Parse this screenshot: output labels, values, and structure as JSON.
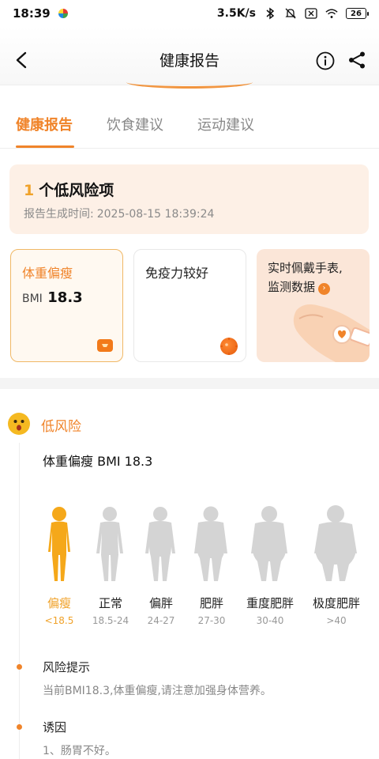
{
  "status": {
    "time": "18:39",
    "network_speed": "3.5K/s",
    "battery": "26"
  },
  "nav": {
    "title": "健康报告"
  },
  "tabs": [
    {
      "label": "健康报告",
      "active": true
    },
    {
      "label": "饮食建议",
      "active": false
    },
    {
      "label": "运动建议",
      "active": false
    }
  ],
  "summary": {
    "risk_count": "1",
    "risk_text": "个低风险项",
    "time_label": "报告生成时间:",
    "time_value": "2025-08-15 18:39:24"
  },
  "cards": {
    "weight": {
      "label": "体重偏瘦",
      "bmi_label": "BMI",
      "bmi_value": "18.3"
    },
    "immunity": {
      "label": "免疫力较好"
    },
    "watch": {
      "line1": "实时佩戴手表,",
      "line2": "监测数据"
    }
  },
  "risk_level": {
    "label": "低风险",
    "bmi_title": "体重偏瘦  BMI 18.3"
  },
  "bmi_categories": [
    {
      "name": "偏瘦",
      "range": "<18.5",
      "active": true
    },
    {
      "name": "正常",
      "range": "18.5-24",
      "active": false
    },
    {
      "name": "偏胖",
      "range": "24-27",
      "active": false
    },
    {
      "name": "肥胖",
      "range": "27-30",
      "active": false
    },
    {
      "name": "重度肥胖",
      "range": "30-40",
      "active": false
    },
    {
      "name": "极度肥胖",
      "range": ">40",
      "active": false
    }
  ],
  "tips": {
    "risk_title": "风险提示",
    "risk_text": "当前BMI18.3,体重偏瘦,请注意加强身体营养。",
    "cause_title": "诱因",
    "cause_text": "1、肠胃不好。"
  },
  "colors": {
    "accent": "#f0842a",
    "active_figure": "#f5a81a",
    "inactive_figure": "#d4d4d4"
  }
}
